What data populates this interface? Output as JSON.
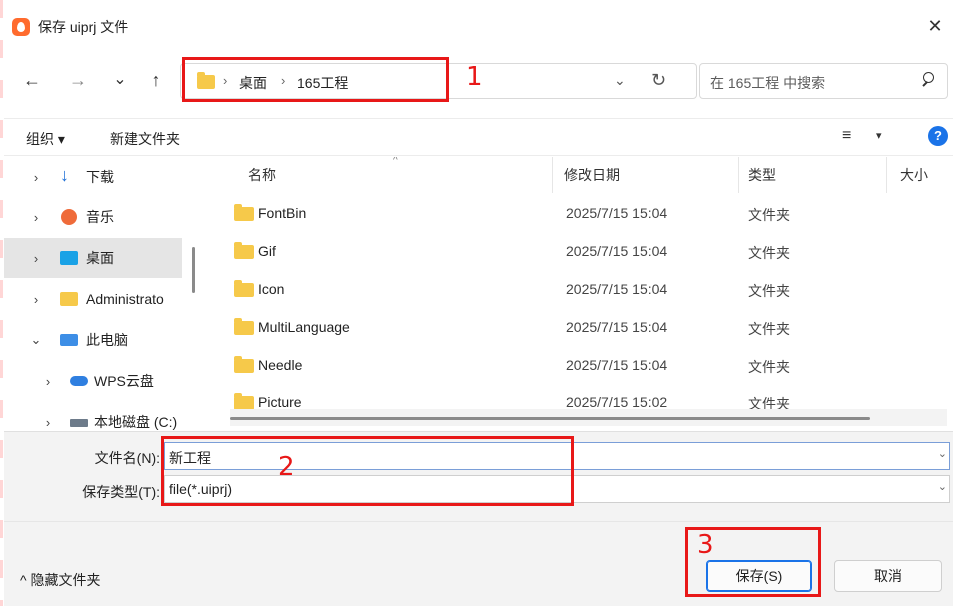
{
  "window": {
    "title": "保存 uiprj 文件",
    "close_glyph": "✕"
  },
  "nav": {
    "back_glyph": "←",
    "forward_glyph": "→",
    "recent_glyph": "⌄",
    "up_glyph": "↑",
    "breadcrumb": [
      "桌面",
      "165工程"
    ],
    "crumb_sep": "›",
    "address_dropdown_glyph": "⌄",
    "refresh_glyph": "↻",
    "search_placeholder": "在 165工程 中搜索"
  },
  "toolbar": {
    "organize_label": "组织 ▾",
    "new_folder_label": "新建文件夹",
    "view_glyph": "≡",
    "view_drop_glyph": "▾",
    "help_glyph": "?"
  },
  "sidebar": {
    "items": [
      {
        "label": "下载",
        "arrow": "›"
      },
      {
        "label": "音乐",
        "arrow": "›"
      },
      {
        "label": "桌面",
        "arrow": "›"
      },
      {
        "label": "Administrato",
        "arrow": "›"
      },
      {
        "label": "此电脑",
        "arrow": "⌄"
      },
      {
        "label": "WPS云盘",
        "arrow": "›"
      },
      {
        "label": "本地磁盘 (C:)",
        "arrow": "›"
      }
    ]
  },
  "files": {
    "columns": {
      "name": "名称",
      "date": "修改日期",
      "type": "类型",
      "size": "大小"
    },
    "sort_glyph": "^",
    "rows": [
      {
        "name": "FontBin",
        "date": "2025/7/15 15:04",
        "type": "文件夹"
      },
      {
        "name": "Gif",
        "date": "2025/7/15 15:04",
        "type": "文件夹"
      },
      {
        "name": "Icon",
        "date": "2025/7/15 15:04",
        "type": "文件夹"
      },
      {
        "name": "MultiLanguage",
        "date": "2025/7/15 15:04",
        "type": "文件夹"
      },
      {
        "name": "Needle",
        "date": "2025/7/15 15:04",
        "type": "文件夹"
      },
      {
        "name": "Picture",
        "date": "2025/7/15 15:02",
        "type": "文件夹"
      }
    ]
  },
  "form": {
    "filename_label": "文件名(N):",
    "filename_value": "新工程",
    "filetype_label": "保存类型(T):",
    "filetype_value": "file(*.uiprj)",
    "dropdown_glyph": "⌄"
  },
  "footer": {
    "hide_folders_label": "^ 隐藏文件夹",
    "save_label": "保存(S)",
    "cancel_label": "取消"
  },
  "annotations": {
    "one": "1",
    "two": "2",
    "three": "3",
    "color": "#e81818"
  }
}
